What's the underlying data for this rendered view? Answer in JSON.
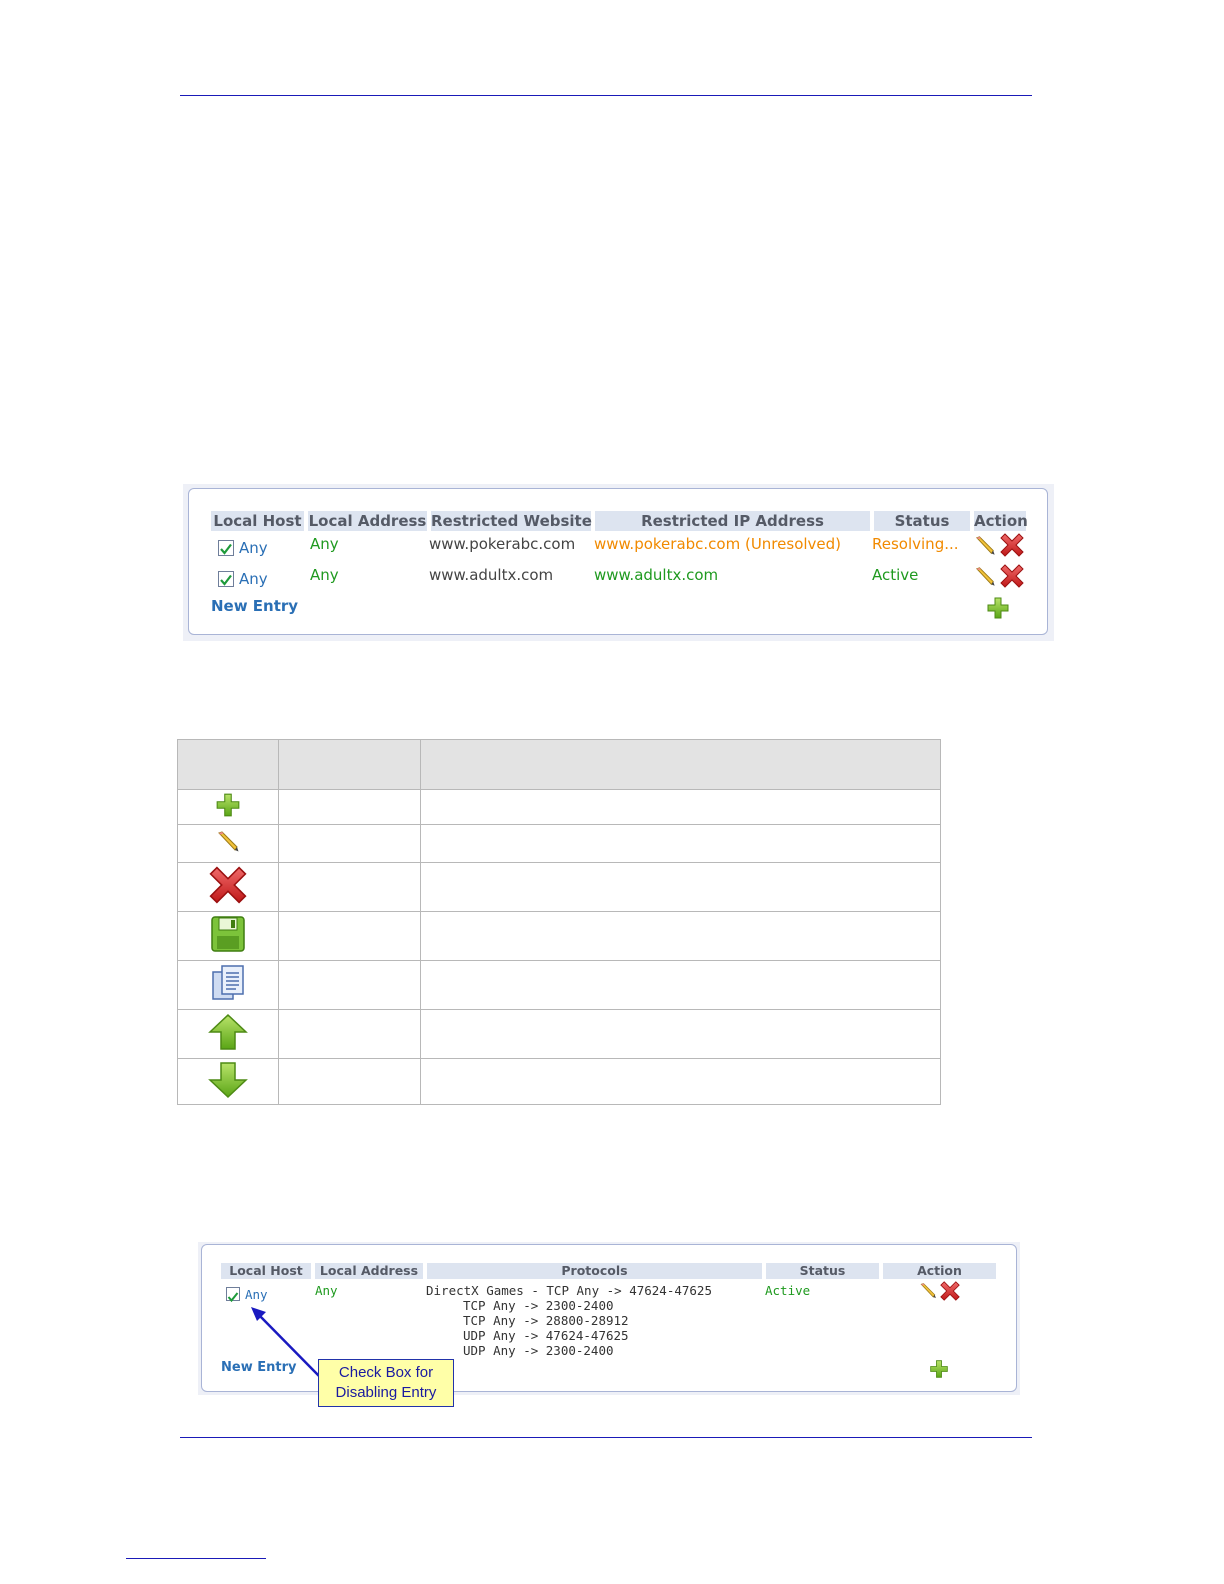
{
  "screenshot1": {
    "headers": [
      "Local Host",
      "Local Address",
      "Restricted Website",
      "Restricted IP Address",
      "Status",
      "Action"
    ],
    "rows": [
      {
        "local_host": "Any",
        "local_address": "Any",
        "website": "www.pokerabc.com",
        "ip_address": "www.pokerabc.com (Unresolved)",
        "status": "Resolving...",
        "checked": true
      },
      {
        "local_host": "Any",
        "local_address": "Any",
        "website": "www.adultx.com",
        "ip_address": "www.adultx.com",
        "status": "Active",
        "checked": true
      }
    ],
    "new_entry": "New Entry"
  },
  "icon_table": {
    "icons": [
      "plus-icon",
      "pencil-icon",
      "delete-x-icon",
      "save-disk-icon",
      "copy-documents-icon",
      "arrow-up-icon",
      "arrow-down-icon"
    ]
  },
  "screenshot2": {
    "headers": [
      "Local Host",
      "Local Address",
      "Protocols",
      "Status",
      "Action"
    ],
    "row": {
      "local_host": "Any",
      "local_address": "Any",
      "protocols": [
        "DirectX Games - TCP Any -> 47624-47625",
        "TCP Any -> 2300-2400",
        "TCP Any -> 28800-28912",
        "UDP Any -> 47624-47625",
        "UDP Any -> 2300-2400"
      ],
      "status": "Active",
      "checked": true
    },
    "new_entry": "New Entry",
    "callout": [
      "Check Box for",
      "Disabling Entry"
    ]
  },
  "colors": {
    "rule": "#1a1ab8",
    "link_blue": "#2a6fb5",
    "active_green": "#1f9a1f",
    "resolving_orange": "#f18a00"
  }
}
